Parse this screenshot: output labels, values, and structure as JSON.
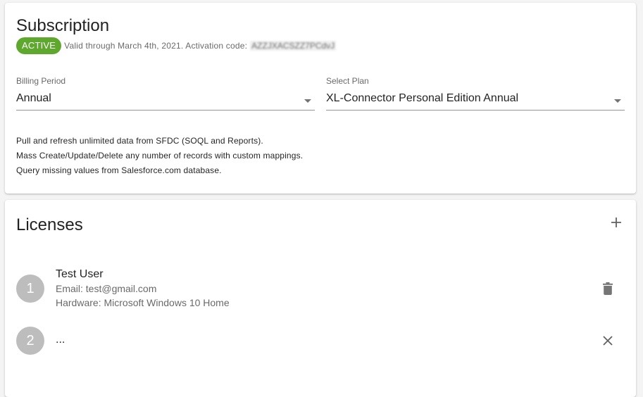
{
  "subscription": {
    "title": "Subscription",
    "status_badge": "ACTIVE",
    "valid_text": "Valid through March 4th, 2021. Activation code:",
    "activation_code": "AZZJXACSZZ7PCdvJ",
    "billing_period": {
      "label": "Billing Period",
      "value": "Annual"
    },
    "plan": {
      "label": "Select Plan",
      "value": "XL-Connector Personal Edition Annual"
    },
    "features": [
      "Pull and refresh unlimited data from SFDC (SOQL and Reports).",
      "Mass Create/Update/Delete any number of records with custom mappings.",
      "Query missing values from Salesforce.com database."
    ]
  },
  "licenses": {
    "title": "Licenses",
    "add_icon": "plus-icon",
    "items": [
      {
        "number": "1",
        "name": "Test User",
        "email": "Email: test@gmail.com",
        "hardware": "Hardware: Microsoft Windows 10 Home",
        "action_icon": "trash-icon"
      },
      {
        "number": "2",
        "name": "...",
        "action_icon": "close-icon"
      }
    ]
  },
  "colors": {
    "active_badge": "#5fa82e",
    "avatar": "#bdbdbd",
    "icon": "#757575"
  }
}
